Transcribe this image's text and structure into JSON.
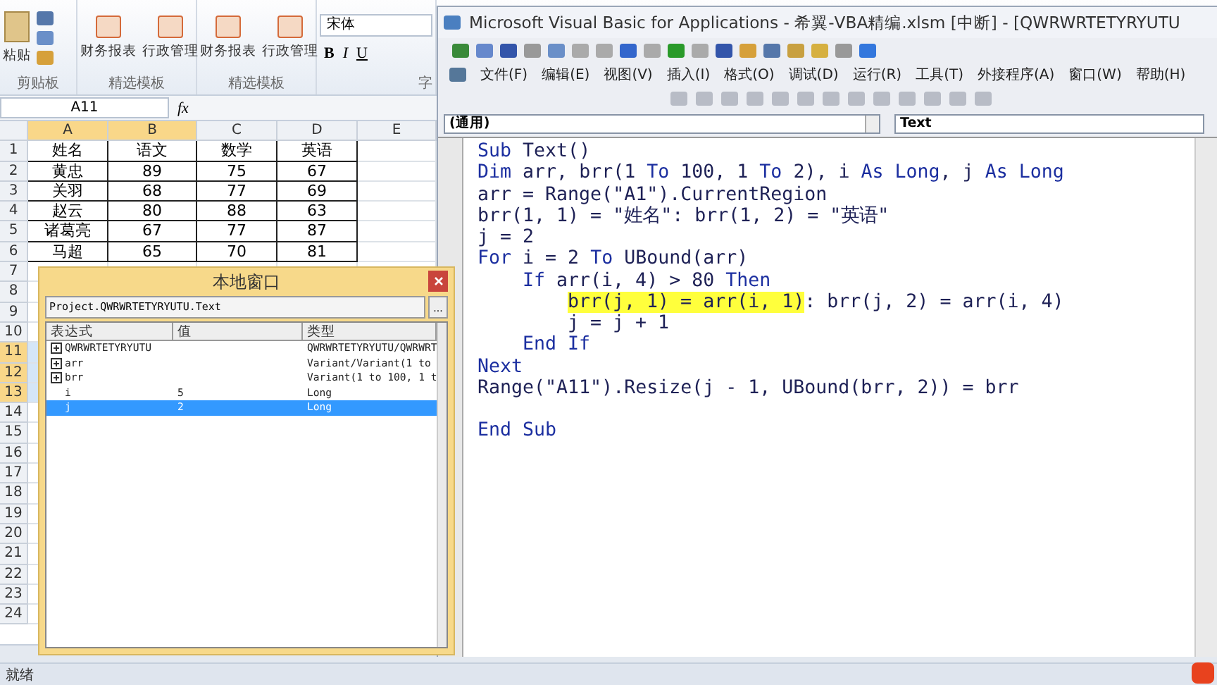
{
  "excel": {
    "ribbon": {
      "groups": [
        {
          "kind": "clipboard",
          "label": "剪贴板",
          "paste": "粘贴"
        },
        {
          "kind": "templates",
          "label": "精选模板",
          "items": [
            "财务报表",
            "行政管理"
          ]
        },
        {
          "kind": "templates",
          "label": "精选模板",
          "items": [
            "财务报表",
            "行政管理"
          ]
        },
        {
          "kind": "font",
          "label": "字",
          "font_name": "宋体",
          "buttons": [
            "B",
            "I",
            "U"
          ]
        }
      ]
    },
    "name_box": "A11",
    "fx": "fx",
    "columns": [
      {
        "label": "A",
        "selected": true
      },
      {
        "label": "B",
        "selected": true
      },
      {
        "label": "C",
        "selected": false
      },
      {
        "label": "D",
        "selected": false
      },
      {
        "label": "E",
        "selected": false
      }
    ],
    "rows": [
      {
        "number": "1",
        "selected": false,
        "cells": [
          "姓名",
          "语文",
          "数学",
          "英语"
        ]
      },
      {
        "number": "2",
        "selected": false,
        "cells": [
          "黄忠",
          "89",
          "75",
          "67"
        ]
      },
      {
        "number": "3",
        "selected": false,
        "cells": [
          "关羽",
          "68",
          "77",
          "69"
        ]
      },
      {
        "number": "4",
        "selected": false,
        "cells": [
          "赵云",
          "80",
          "88",
          "63"
        ]
      },
      {
        "number": "5",
        "selected": false,
        "cells": [
          "诸葛亮",
          "67",
          "77",
          "87"
        ]
      },
      {
        "number": "6",
        "selected": false,
        "cells": [
          "马超",
          "65",
          "70",
          "81"
        ]
      },
      {
        "number": "7",
        "selected": false
      },
      {
        "number": "8",
        "selected": false
      },
      {
        "number": "9",
        "selected": false
      },
      {
        "number": "10",
        "selected": false
      },
      {
        "number": "11",
        "selected": true
      },
      {
        "number": "12",
        "selected": true
      },
      {
        "number": "13",
        "selected": true
      },
      {
        "number": "14",
        "selected": false
      },
      {
        "number": "15",
        "selected": false
      },
      {
        "number": "16",
        "selected": false
      },
      {
        "number": "17",
        "selected": false
      },
      {
        "number": "18",
        "selected": false
      },
      {
        "number": "19",
        "selected": false
      },
      {
        "number": "20",
        "selected": false
      },
      {
        "number": "21",
        "selected": false
      },
      {
        "number": "22",
        "selected": false
      },
      {
        "number": "23",
        "selected": false
      },
      {
        "number": "24",
        "selected": false
      }
    ],
    "status": "就绪"
  },
  "vba": {
    "title": "Microsoft Visual Basic for Applications - 希翼-VBA精编.xlsm [中断] - [QWRWRTETYRYUTU",
    "menu": [
      "文件(F)",
      "编辑(E)",
      "视图(V)",
      "插入(I)",
      "格式(O)",
      "调试(D)",
      "运行(R)",
      "工具(T)",
      "外接程序(A)",
      "窗口(W)",
      "帮助(H)"
    ],
    "object_combo": "(通用)",
    "procedure_combo": "Text",
    "code": [
      {
        "tokens": [
          {
            "kind": "kw",
            "text": "Sub"
          },
          {
            "kind": "id",
            "text": " Text()"
          }
        ]
      },
      {
        "tokens": [
          {
            "kind": "kw",
            "text": "Dim"
          },
          {
            "kind": "id",
            "text": " arr, brr(1 "
          },
          {
            "kind": "kw",
            "text": "To"
          },
          {
            "kind": "id",
            "text": " 100, 1 "
          },
          {
            "kind": "kw",
            "text": "To"
          },
          {
            "kind": "id",
            "text": " 2), i "
          },
          {
            "kind": "kw",
            "text": "As Long"
          },
          {
            "kind": "id",
            "text": ", j "
          },
          {
            "kind": "kw",
            "text": "As Long"
          }
        ]
      },
      {
        "tokens": [
          {
            "kind": "id",
            "text": "arr = Range(\"A1\").CurrentRegion"
          }
        ]
      },
      {
        "tokens": [
          {
            "kind": "id",
            "text": "brr(1, 1) = \"姓名\": brr(1, 2) = \"英语\""
          }
        ]
      },
      {
        "tokens": [
          {
            "kind": "id",
            "text": "j = 2"
          }
        ]
      },
      {
        "tokens": [
          {
            "kind": "kw",
            "text": "For"
          },
          {
            "kind": "id",
            "text": " i = 2 "
          },
          {
            "kind": "kw",
            "text": "To"
          },
          {
            "kind": "id",
            "text": " UBound(arr)"
          }
        ],
        "children": [
          {
            "tokens": [
              {
                "kind": "kw",
                "text": "If"
              },
              {
                "kind": "id",
                "text": " arr(i, 4) > 80 "
              },
              {
                "kind": "kw",
                "text": "Then"
              }
            ],
            "children": [
              {
                "tokens": [
                  {
                    "kind": "current",
                    "text": "brr(j, 1) = arr(i, 1)"
                  },
                  {
                    "kind": "id",
                    "text": ": brr(j, 2) = arr(i, 4)"
                  }
                ]
              },
              {
                "tokens": [
                  {
                    "kind": "id",
                    "text": "j = j + 1"
                  }
                ]
              }
            ]
          },
          {
            "tokens": [
              {
                "kind": "kw",
                "text": "End If"
              }
            ]
          }
        ]
      },
      {
        "tokens": [
          {
            "kind": "kw",
            "text": "Next"
          }
        ]
      },
      {
        "tokens": [
          {
            "kind": "id",
            "text": "Range(\"A11\").Resize(j - 1, UBound(brr, 2)) = brr"
          }
        ]
      },
      {
        "tokens": [
          {
            "kind": "kw",
            "text": "End Sub"
          }
        ],
        "blank_before": true
      }
    ]
  },
  "locals": {
    "title": "本地窗口",
    "context": "Project.QWRWRTETYRYUTU.Text",
    "more": "...",
    "columns": [
      "表达式",
      "值",
      "类型"
    ],
    "rows": [
      {
        "kind": "object",
        "expression": "QWRWRTETYRYUTU",
        "type": "QWRWRTETYRYUTU/QWRWRT",
        "selected": false
      },
      {
        "kind": "object",
        "expression": "arr",
        "type": "Variant/Variant(1 to",
        "selected": false
      },
      {
        "kind": "object",
        "expression": "brr",
        "type": "Variant(1 to 100, 1 t",
        "selected": false
      },
      {
        "kind": "scalar",
        "expression": "i",
        "value": "5",
        "type": "Long",
        "selected": false
      },
      {
        "kind": "scalar",
        "expression": "j",
        "value": "2",
        "type": "Long",
        "selected": true
      }
    ]
  }
}
